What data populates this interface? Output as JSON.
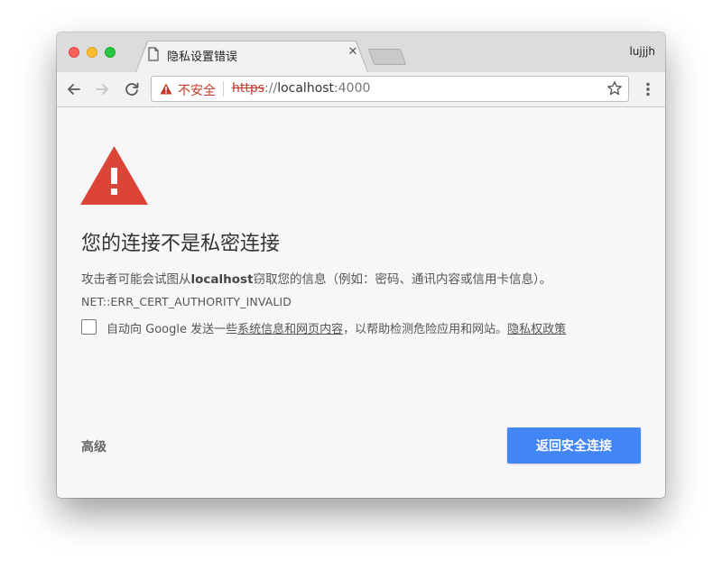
{
  "tab": {
    "title": "隐私设置错误",
    "close_glyph": "✕"
  },
  "profile": {
    "name": "lujjjh"
  },
  "omnibox": {
    "security_label": "不安全",
    "url_scheme": "https",
    "url_separator": "://",
    "url_host": "localhost",
    "url_port": ":4000"
  },
  "page": {
    "heading": "您的连接不是私密连接",
    "desc_before": "攻击者可能会试图从",
    "desc_host": "localhost",
    "desc_after": "窃取您的信息（例如：密码、通讯内容或信用卡信息）。",
    "error_code": "NET::ERR_CERT_AUTHORITY_INVALID",
    "report_prefix": "自动向 Google 发送一些",
    "report_link": "系统信息和网页内容",
    "report_middle": "，以帮助检测危险应用和网站。",
    "privacy_link": "隐私权政策",
    "advanced_label": "高级",
    "back_button_label": "返回安全连接"
  },
  "colors": {
    "warning_red": "#db4437",
    "insecure_text": "#c53929",
    "primary_button": "#4285f4"
  },
  "icons": [
    "document-icon",
    "close-icon",
    "back-arrow-icon",
    "forward-arrow-icon",
    "reload-icon",
    "warning-triangle-icon",
    "star-icon",
    "more-vert-icon"
  ]
}
